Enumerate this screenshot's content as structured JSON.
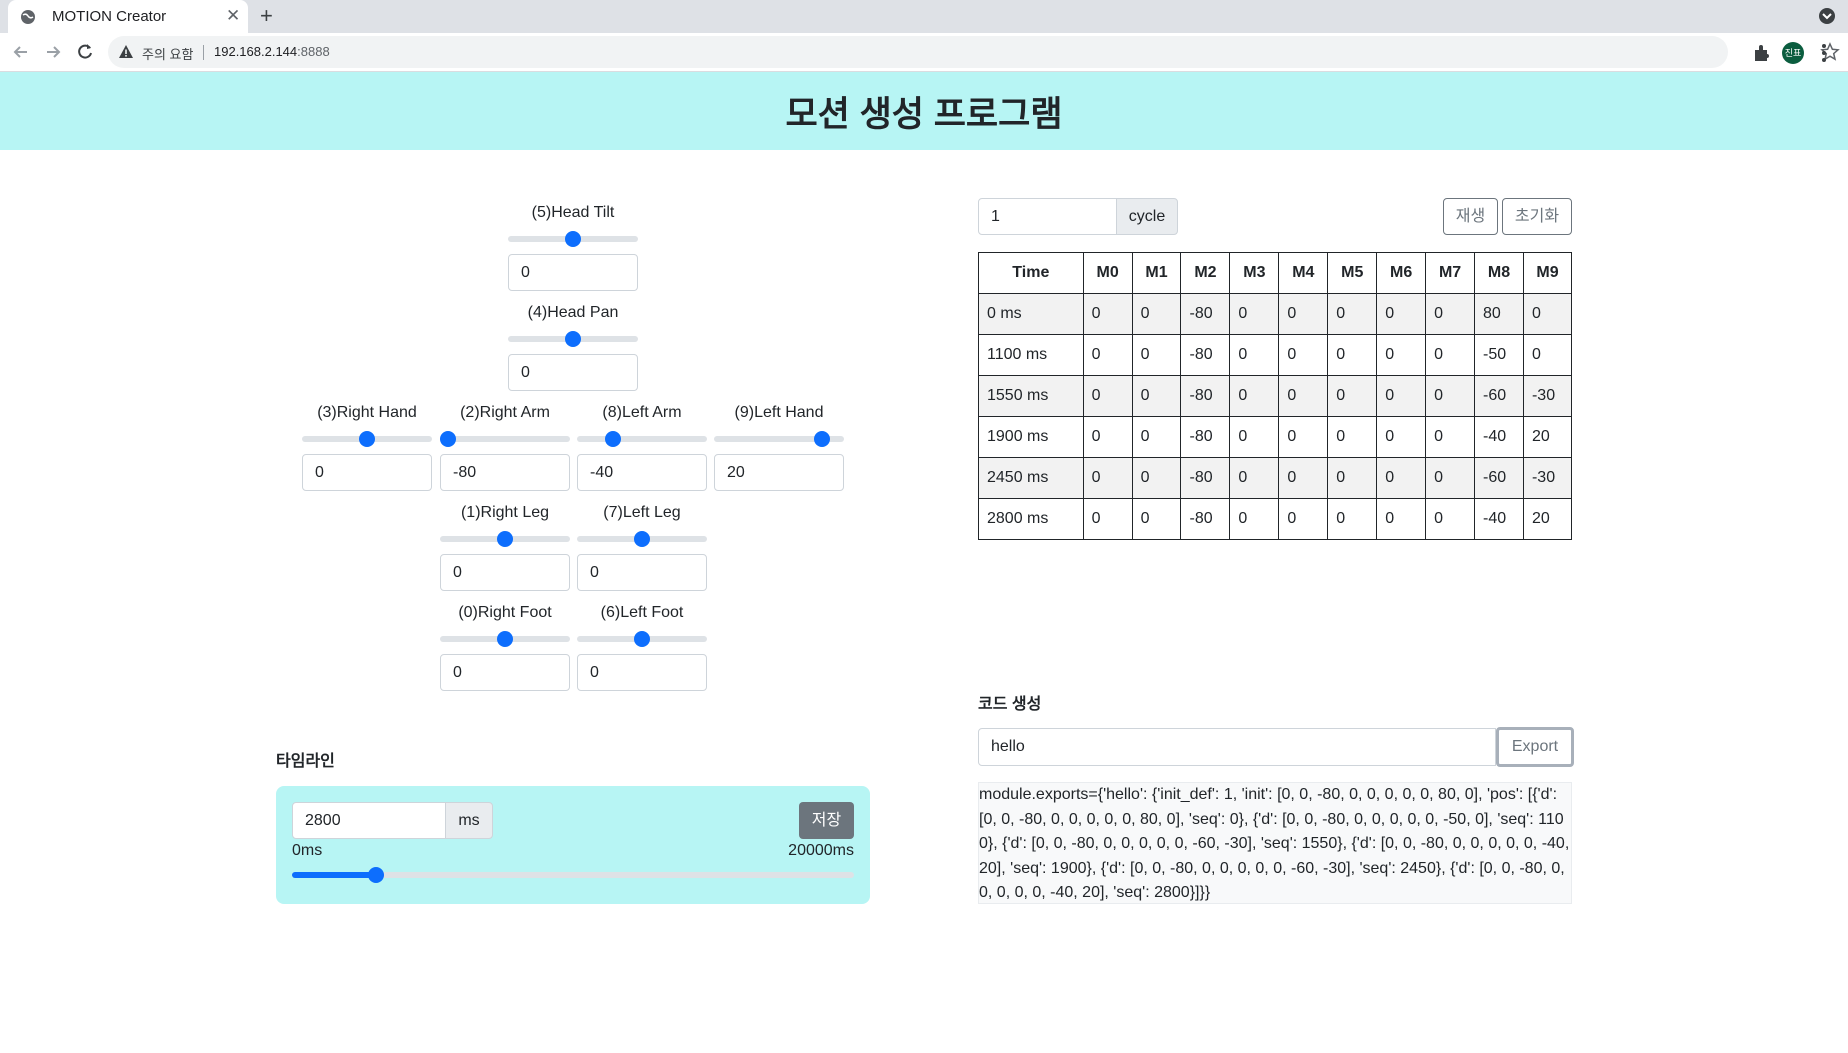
{
  "browser": {
    "tab_title": "MOTION Creator",
    "security_label": "주의 요함",
    "url_host": "192.168.2.144",
    "url_port": ":8888",
    "profile_initials": "진표"
  },
  "page": {
    "title": "모션 생성 프로그램"
  },
  "joints": {
    "head_tilt": {
      "label": "(5)Head Tilt",
      "value": "0"
    },
    "head_pan": {
      "label": "(4)Head Pan",
      "value": "0"
    },
    "right_hand": {
      "label": "(3)Right Hand",
      "value": "0"
    },
    "right_arm": {
      "label": "(2)Right Arm",
      "value": "-80"
    },
    "left_arm": {
      "label": "(8)Left Arm",
      "value": "-40"
    },
    "left_hand": {
      "label": "(9)Left Hand",
      "value": "20"
    },
    "right_leg": {
      "label": "(1)Right Leg",
      "value": "0"
    },
    "left_leg": {
      "label": "(7)Left Leg",
      "value": "0"
    },
    "right_foot": {
      "label": "(0)Right Foot",
      "value": "0"
    },
    "left_foot": {
      "label": "(6)Left Foot",
      "value": "0"
    }
  },
  "timeline": {
    "title": "타임라인",
    "time_value": "2800",
    "unit": "ms",
    "save_label": "저장",
    "min_label": "0ms",
    "max_label": "20000ms",
    "position_ms": 2800,
    "max_ms": 20000
  },
  "playback": {
    "cycle_value": "1",
    "cycle_label": "cycle",
    "play_label": "재생",
    "reset_label": "초기화"
  },
  "motion_table": {
    "headers": [
      "Time",
      "M0",
      "M1",
      "M2",
      "M3",
      "M4",
      "M5",
      "M6",
      "M7",
      "M8",
      "M9"
    ],
    "rows": [
      [
        "0 ms",
        "0",
        "0",
        "-80",
        "0",
        "0",
        "0",
        "0",
        "0",
        "80",
        "0"
      ],
      [
        "1100 ms",
        "0",
        "0",
        "-80",
        "0",
        "0",
        "0",
        "0",
        "0",
        "-50",
        "0"
      ],
      [
        "1550 ms",
        "0",
        "0",
        "-80",
        "0",
        "0",
        "0",
        "0",
        "0",
        "-60",
        "-30"
      ],
      [
        "1900 ms",
        "0",
        "0",
        "-80",
        "0",
        "0",
        "0",
        "0",
        "0",
        "-40",
        "20"
      ],
      [
        "2450 ms",
        "0",
        "0",
        "-80",
        "0",
        "0",
        "0",
        "0",
        "0",
        "-60",
        "-30"
      ],
      [
        "2800 ms",
        "0",
        "0",
        "-80",
        "0",
        "0",
        "0",
        "0",
        "0",
        "-40",
        "20"
      ]
    ]
  },
  "code_gen": {
    "title": "코드 생성",
    "name_value": "hello",
    "export_label": "Export",
    "output": "module.exports={'hello': {'init_def': 1, 'init': [0, 0, -80, 0, 0, 0, 0, 0, 80, 0], 'pos': [{'d': [0, 0, -80, 0, 0, 0, 0, 0, 80, 0], 'seq': 0}, {'d': [0, 0, -80, 0, 0, 0, 0, 0, -50, 0], 'seq': 1100}, {'d': [0, 0, -80, 0, 0, 0, 0, 0, -60, -30], 'seq': 1550}, {'d': [0, 0, -80, 0, 0, 0, 0, 0, -40, 20], 'seq': 1900}, {'d': [0, 0, -80, 0, 0, 0, 0, 0, -60, -30], 'seq': 2450}, {'d': [0, 0, -80, 0, 0, 0, 0, 0, -40, 20], 'seq': 2800}]}}"
  },
  "colors": {
    "header_bg": "#b7f5f4",
    "accent": "#0d6efd",
    "secondary": "#6c757d"
  }
}
